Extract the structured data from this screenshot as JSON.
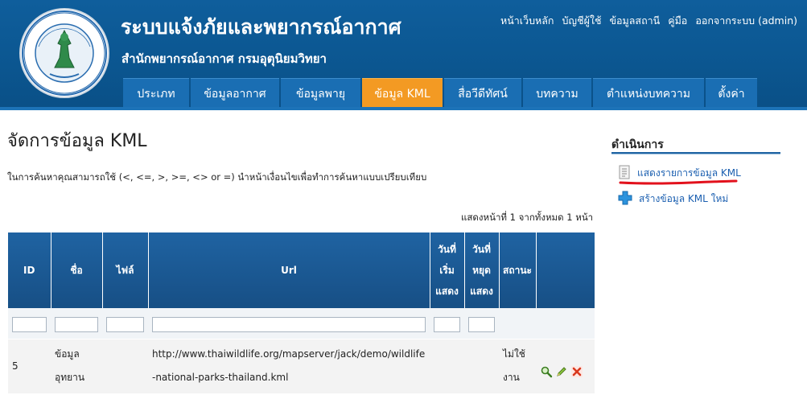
{
  "header": {
    "title": "ระบบแจ้งภัยและพยากรณ์อากาศ",
    "subtitle": "สำนักพยากรณ์อากาศ กรมอุตุนิยมวิทยา",
    "logo_text_top": "กรมอุตุนิยมวิทยา",
    "logo_text_bottom": "METEOROLOGICAL DEPARTMENT",
    "top_links": [
      "หน้าเว็บหลัก",
      "บัญชีผู้ใช้",
      "ข้อมูลสถานี",
      "คู่มือ",
      "ออกจากระบบ (admin)"
    ]
  },
  "nav": {
    "tabs": [
      "ประเภท",
      "ข้อมูลอากาศ",
      "ข้อมูลพายุ",
      "ข้อมูล KML",
      "สื่อวีดีทัศน์",
      "บทความ",
      "ตำแหน่งบทความ",
      "ตั้งค่า"
    ],
    "active_index": 3
  },
  "main": {
    "title": "จัดการข้อมูล KML",
    "hint": "ในการค้นหาคุณสามารถใช้ (<, <=, >, >=, <> or =) นำหน้าเงื่อนไขเพื่อทำการค้นหาแบบเปรียบเทียบ",
    "summary": "แสดงหน้าที่ 1 จากทั้งหมด 1 หน้า"
  },
  "table": {
    "columns": {
      "id": "ID",
      "name": "ชื่อ",
      "file": "ไฟล์",
      "url": "Url",
      "start_l1": "วันที่",
      "start_l2": "เริ่ม",
      "start_l3": "แสดง",
      "end_l1": "วันที่",
      "end_l2": "หยุด",
      "end_l3": "แสดง",
      "status": "สถานะ"
    },
    "rows": [
      {
        "id": "5",
        "name": "ข้อมูลอุทยาน",
        "file": "",
        "url": "http://www.thaiwildlife.org/mapserver/jack/demo/wildlife-national-parks-thailand.kml",
        "start": "",
        "end": "",
        "status": "ไม่ใช้งาน"
      }
    ]
  },
  "sidebar": {
    "title": "ดำเนินการ",
    "items": [
      "แสดงรายการข้อมูล KML",
      "สร้างข้อมูล KML ใหม่"
    ]
  },
  "colors": {
    "header_blue": "#0c5a96",
    "active_tab": "#f39a23",
    "link": "#1b5fb0",
    "annotation_red": "#e2111c"
  },
  "icons": [
    "view-icon",
    "edit-icon",
    "delete-icon",
    "list-icon",
    "add-icon"
  ]
}
